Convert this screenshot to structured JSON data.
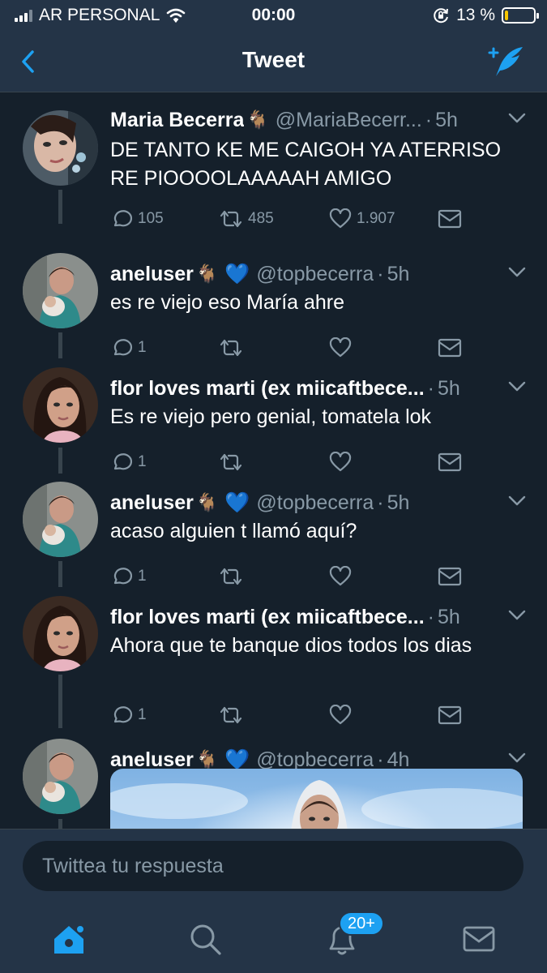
{
  "status_bar": {
    "carrier": "AR PERSONAL",
    "time": "00:00",
    "battery": "13 %",
    "battery_level": 0.13,
    "icons": [
      "signal-icon",
      "wifi-icon",
      "rotation-lock-icon",
      "battery-icon"
    ]
  },
  "nav": {
    "title": "Tweet",
    "back_icon": "chevron-left-icon",
    "compose_icon": "compose-tweet-icon"
  },
  "tweets": [
    {
      "name": "Maria Becerra",
      "emoji": "🐐",
      "heart": "",
      "handle": "@MariaBecerr...",
      "dot": "·",
      "time": "5h",
      "text": "DE TANTO KE ME CAIGOH YA ATERRISO RE PIOOOOLAAAAAH AMIGO",
      "replies": "105",
      "retweets": "485",
      "likes": "1.907"
    },
    {
      "name": "aneluser",
      "emoji": "🐐",
      "heart": "💙",
      "handle": "@topbecerra",
      "dot": "·",
      "time": "5h",
      "text": "es re viejo eso María ahre",
      "replies": "1",
      "retweets": "",
      "likes": ""
    },
    {
      "name": "flor loves marti (ex miicaftbece...",
      "emoji": "",
      "heart": "",
      "handle": "",
      "dot": "·",
      "time": "5h",
      "text": "Es re viejo pero genial, tomatela lok",
      "replies": "1",
      "retweets": "",
      "likes": ""
    },
    {
      "name": "aneluser",
      "emoji": "🐐",
      "heart": "💙",
      "handle": "@topbecerra",
      "dot": "·",
      "time": "5h",
      "text": "acaso alguien t llamó aquí?",
      "replies": "1",
      "retweets": "",
      "likes": ""
    },
    {
      "name": "flor loves marti (ex miicaftbece...",
      "emoji": "",
      "heart": "",
      "handle": "",
      "dot": "·",
      "time": "5h",
      "text": "Ahora que te banque dios todos los dias",
      "replies": "1",
      "retweets": "",
      "likes": ""
    },
    {
      "name": "aneluser",
      "emoji": "🐐",
      "heart": "💙",
      "handle": "@topbecerra",
      "dot": "·",
      "time": "4h",
      "text": "",
      "replies": "",
      "retweets": "",
      "likes": ""
    }
  ],
  "reply": {
    "placeholder": "Twittea tu respuesta"
  },
  "tabbar": {
    "notifications_badge": "20+",
    "items": [
      "home-icon",
      "search-icon",
      "notifications-icon",
      "messages-icon"
    ]
  },
  "colors": {
    "background": "#15202b",
    "bar": "#243447",
    "accent": "#1da1f2",
    "secondary_text": "#8899a6",
    "battery_low": "#f7c600"
  }
}
